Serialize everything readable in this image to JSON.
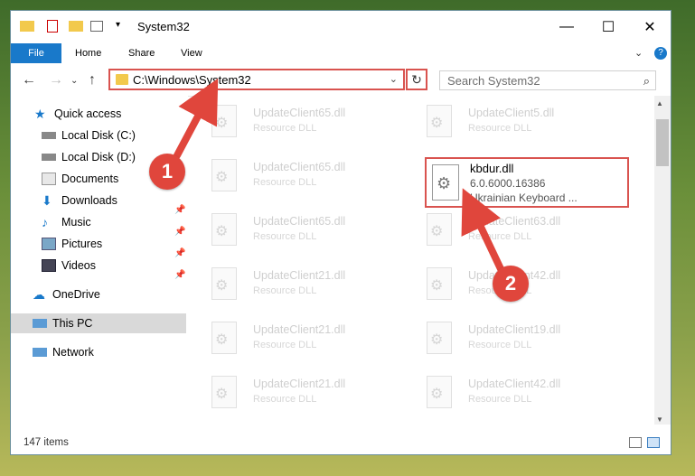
{
  "window": {
    "title": "System32"
  },
  "window_controls": {
    "minimize": "—",
    "maximize": "☐",
    "close": "✕"
  },
  "ribbon": {
    "file": "File",
    "home": "Home",
    "share": "Share",
    "view": "View",
    "expand": "⌄",
    "help": "?"
  },
  "nav": {
    "back": "←",
    "forward": "→",
    "dropdown": "⌄",
    "up": "↑"
  },
  "address": {
    "path": "C:\\Windows\\System32",
    "dropdown": "⌄",
    "refresh": "↻"
  },
  "search": {
    "placeholder": "Search System32",
    "icon": "⌕"
  },
  "sidebar": {
    "items": [
      {
        "label": "Quick access",
        "icon": "star-icon"
      },
      {
        "label": "Local Disk (C:)",
        "icon": "drive-icon"
      },
      {
        "label": "Local Disk (D:)",
        "icon": "drive-icon"
      },
      {
        "label": "Documents",
        "icon": "documents-icon"
      },
      {
        "label": "Downloads",
        "icon": "download-icon"
      },
      {
        "label": "Music",
        "icon": "music-icon"
      },
      {
        "label": "Pictures",
        "icon": "pictures-icon"
      },
      {
        "label": "Videos",
        "icon": "videos-icon"
      },
      {
        "label": "OneDrive",
        "icon": "cloud-icon"
      },
      {
        "label": "This PC",
        "icon": "computer-icon"
      },
      {
        "label": "Network",
        "icon": "network-icon"
      }
    ]
  },
  "files": {
    "left": [
      {
        "name": "UpdateClient65.dll",
        "desc": "Resource DLL"
      },
      {
        "name": "UpdateClient65.dll",
        "desc": "Resource DLL"
      },
      {
        "name": "UpdateClient65.dll",
        "desc": "Resource DLL"
      },
      {
        "name": "UpdateClient21.dll",
        "desc": "Resource DLL"
      },
      {
        "name": "UpdateClient21.dll",
        "desc": "Resource DLL"
      },
      {
        "name": "UpdateClient21.dll",
        "desc": "Resource DLL"
      }
    ],
    "right": [
      {
        "name": "UpdateClient5.dll",
        "desc": "Resource DLL"
      },
      {
        "name": "UpdateClient63.dll",
        "desc": "Resource DLL"
      },
      {
        "name": "UpdateClient42.dll",
        "desc": "Resource DLL"
      },
      {
        "name": "UpdateClient19.dll",
        "desc": "Resource DLL"
      },
      {
        "name": "UpdateClient42.dll",
        "desc": "Resource DLL"
      }
    ],
    "highlighted": {
      "name": "kbdur.dll",
      "version": "6.0.6000.16386",
      "desc": "Ukrainian Keyboard ..."
    }
  },
  "status": {
    "count": "147 items"
  },
  "callouts": {
    "one": "1",
    "two": "2"
  },
  "colors": {
    "accent": "#1979ca",
    "callout": "#e0463c"
  }
}
